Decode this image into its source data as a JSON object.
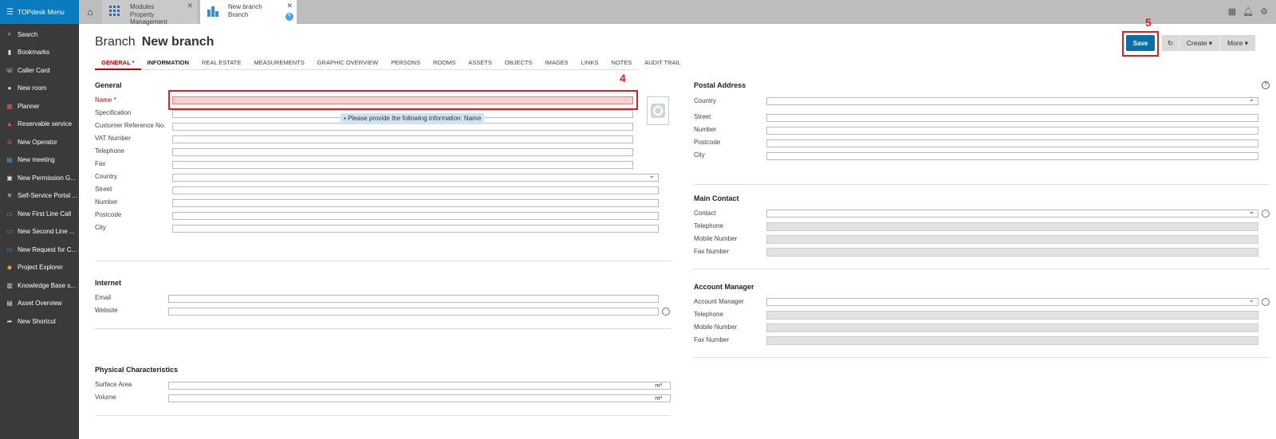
{
  "sidebar": {
    "title": "TOPdesk Menu",
    "items": [
      {
        "label": "Search"
      },
      {
        "label": "Bookmarks"
      },
      {
        "label": "Caller Card"
      },
      {
        "label": "New room"
      },
      {
        "label": "Planner"
      },
      {
        "label": "Reservable service"
      },
      {
        "label": "New Operator"
      },
      {
        "label": "New meeting"
      },
      {
        "label": "New Permission G..."
      },
      {
        "label": "Self-Service Portal ..."
      },
      {
        "label": "New First Line Call"
      },
      {
        "label": "New Second Line ..."
      },
      {
        "label": "New Request for C..."
      },
      {
        "label": "Project Explorer"
      },
      {
        "label": "Knowledge Base s..."
      },
      {
        "label": "Asset Overview"
      },
      {
        "label": "New Shortcut"
      }
    ]
  },
  "window_tabs": [
    {
      "line1": "Modules",
      "line2": "Property Management"
    },
    {
      "line1": "New branch",
      "line2": "Branch"
    }
  ],
  "header": {
    "type": "Branch",
    "name": "New branch"
  },
  "buttons": {
    "save": "Save",
    "create": "Create",
    "more": "More"
  },
  "annotations": {
    "four": "4",
    "five": "5"
  },
  "tabs": [
    "GENERAL *",
    "INFORMATION",
    "REAL ESTATE",
    "MEASUREMENTS",
    "GRAPHIC OVERVIEW",
    "PERSONS",
    "ROOMS",
    "ASSETS",
    "OBJECTS",
    "IMAGES",
    "LINKS",
    "NOTES",
    "AUDIT TRAIL"
  ],
  "general": {
    "title": "General",
    "fields": [
      "Name *",
      "Specification",
      "Customer Reference No.",
      "VAT Number",
      "Telephone",
      "Fax",
      "Country",
      "Street",
      "Number",
      "Postcode",
      "City"
    ],
    "tooltip": "Please provide the following information: Name"
  },
  "internet": {
    "title": "Internet",
    "fields": [
      "Email",
      "Website"
    ]
  },
  "physical": {
    "title": "Physical Characteristics",
    "fields": [
      "Surface Area",
      "Volume"
    ],
    "units": [
      "m²",
      "m³"
    ]
  },
  "postal": {
    "title": "Postal Address",
    "fields": [
      "Country",
      "Street",
      "Number",
      "Postcode",
      "City"
    ]
  },
  "main_contact": {
    "title": "Main Contact",
    "fields": [
      "Contact",
      "Telephone",
      "Mobile Number",
      "Fax Number"
    ]
  },
  "account_manager": {
    "title": "Account Manager",
    "fields": [
      "Account Manager",
      "Telephone",
      "Mobile Number",
      "Fax Number"
    ]
  }
}
